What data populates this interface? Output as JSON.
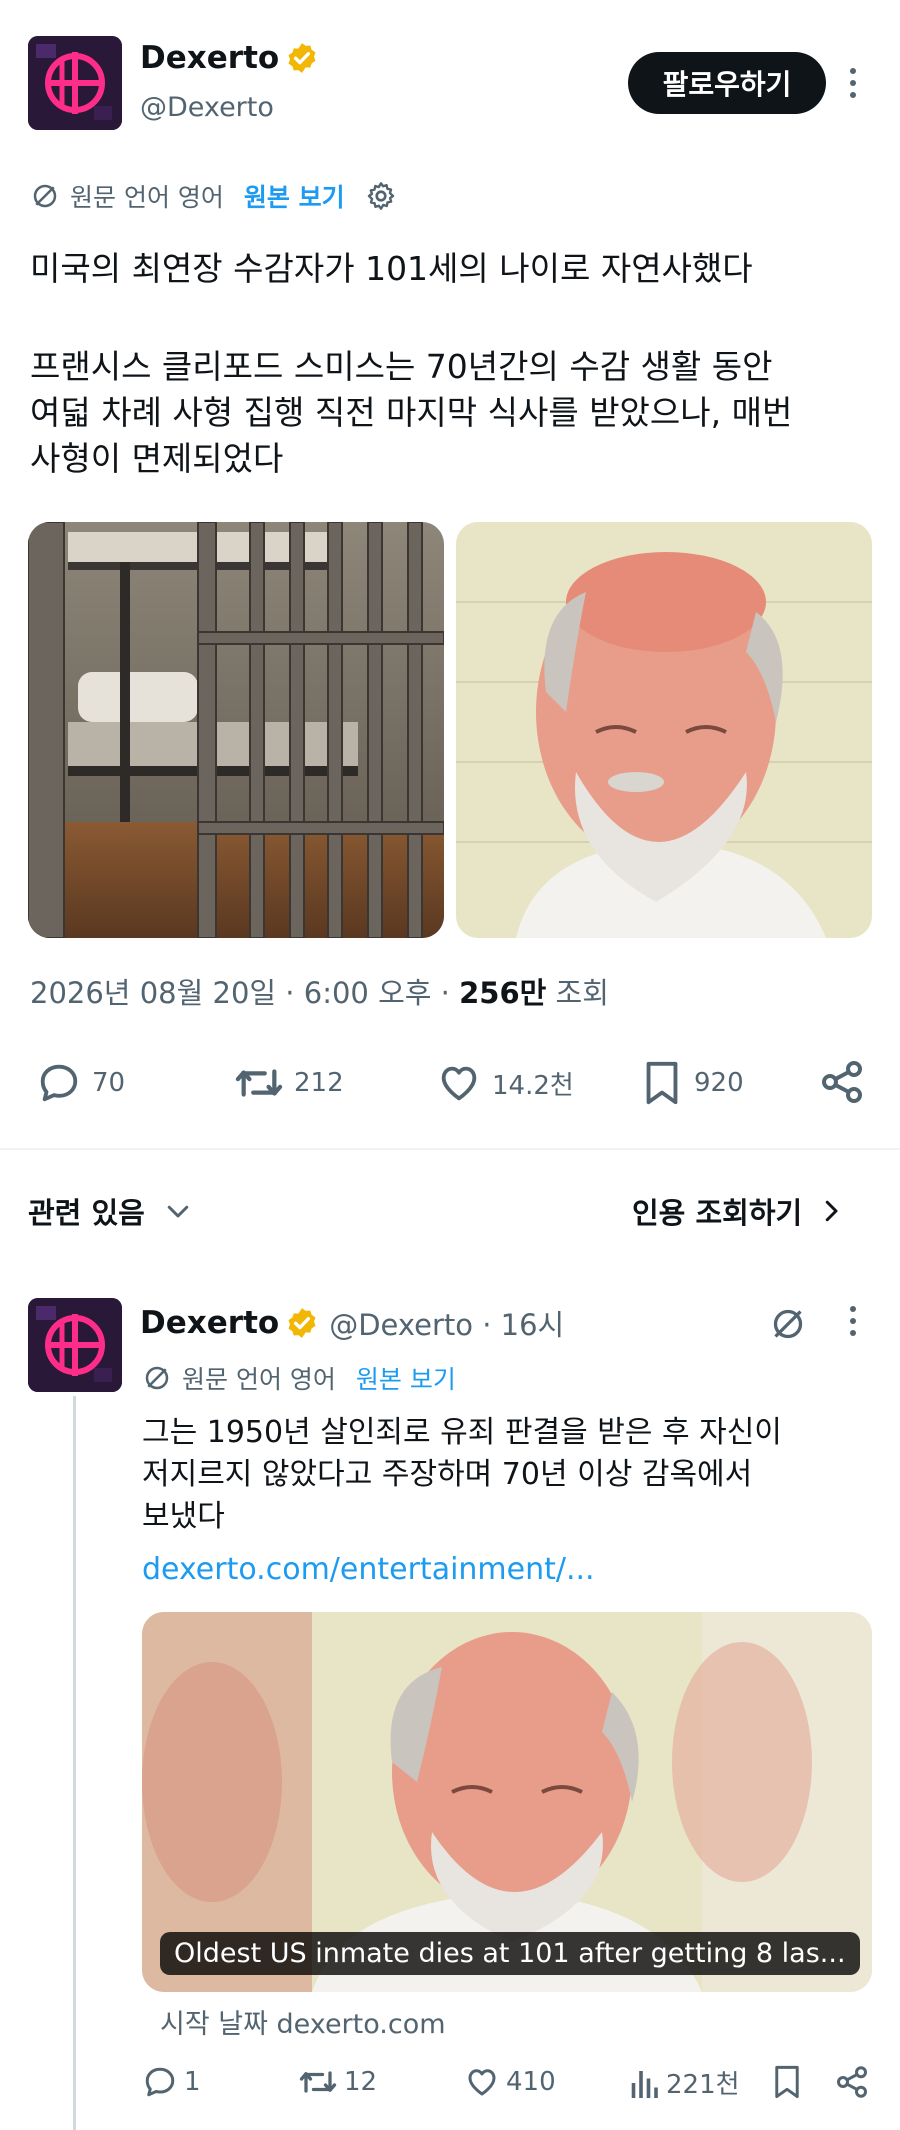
{
  "post": {
    "author": {
      "name": "Dexerto",
      "handle": "@Dexerto",
      "follow_label": "팔로우하기"
    },
    "translation": {
      "source_label": "원문 언어 영어",
      "view_original": "원본 보기"
    },
    "title": "미국의 최연장 수감자가 101세의 나이로 자연사했다",
    "body": "프랜시스 클리포드 스미스는 70년간의 수감 생활 동안\n여덟 차례 사형 집행 직전 마지막 식사를 받았으나, 매번\n사형이 면제되었다",
    "meta": {
      "date": "2026년 08월 20일 · 6:00 오후 · ",
      "views": "256만",
      "views_label": " 조회"
    },
    "actions": {
      "replies": "70",
      "reposts": "212",
      "likes": "14.2천",
      "bookmarks": "920"
    }
  },
  "related": {
    "label": "관련 있음",
    "quotes_label": "인용 조회하기"
  },
  "reply": {
    "author": {
      "name": "Dexerto",
      "handle_time": "@Dexerto · 16시"
    },
    "translation": {
      "source_label": "원문 언어 영어",
      "view_original": "원본 보기"
    },
    "text": "그는 1950년 살인죄로 유죄 판결을 받은 후 자신이\n저지르지 않았다고 주장하며 70년 이상 감옥에서\n보냈다",
    "link": "dexerto.com/entertainment/...",
    "card_caption": "Oldest US inmate dies at 101 after getting 8 las...",
    "source": "시작 날짜 dexerto.com",
    "actions": {
      "replies": "1",
      "reposts": "12",
      "likes": "410",
      "views": "221천"
    }
  },
  "colors": {
    "accent": "#1d9bf0",
    "verified": "#f2b705",
    "text": "#0f1419",
    "muted": "#536471"
  }
}
